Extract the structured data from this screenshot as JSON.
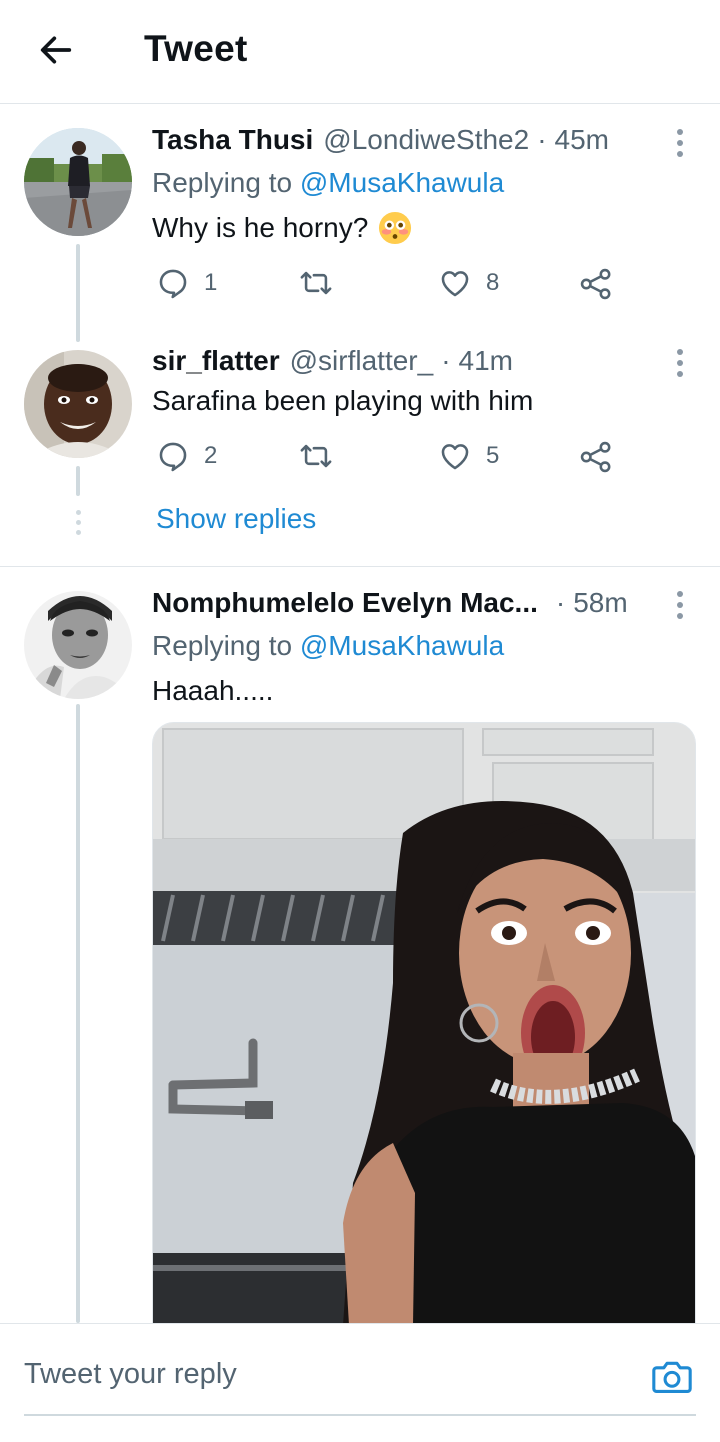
{
  "header": {
    "title": "Tweet"
  },
  "tweets": [
    {
      "name": "Tasha Thusi",
      "handle": "@LondiweSthe2",
      "sep": "·",
      "time": "45m",
      "replying_prefix": "Replying to",
      "replying_to": "@MusaKhawula",
      "text": "Why is he horny?",
      "emoji": "flushed-face",
      "replies": "1",
      "retweets": "",
      "likes": "8"
    },
    {
      "name": "sir_flatter",
      "handle": "@sirflatter_",
      "sep": "·",
      "time": "41m",
      "text": "Sarafina been playing with him",
      "replies": "2",
      "retweets": "",
      "likes": "5"
    },
    {
      "name": "Nomphumelelo Evelyn Mac...",
      "handle": "",
      "sep": "·",
      "time": "58m",
      "replying_prefix": "Replying to",
      "replying_to": "@MusaKhawula",
      "text": "Haaah.....",
      "media": "photo"
    }
  ],
  "show_replies": "Show replies",
  "reply_bar": {
    "placeholder": "Tweet your reply"
  },
  "colors": {
    "accent": "#1f8ad3",
    "thread_line": "#cfd9de",
    "secondary_text": "#536471"
  },
  "icons": [
    "back-arrow-icon",
    "more-vertical-icon",
    "reply-icon",
    "retweet-icon",
    "like-icon",
    "share-icon",
    "camera-icon"
  ]
}
